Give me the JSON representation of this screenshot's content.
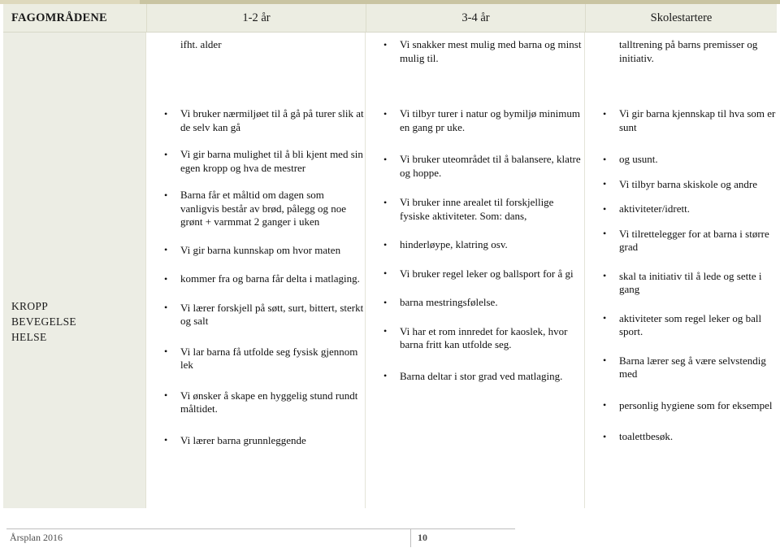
{
  "document": {
    "footer": {
      "left_text": "Årsplan 2016",
      "page_number": "10"
    }
  },
  "table": {
    "headers": {
      "area": "FAGOMRÅDENE",
      "age_1_2": "1-2 år",
      "age_3_4": "3-4 år",
      "school_starters": "Skolestartere"
    },
    "row_label": {
      "line1": "KROPP",
      "line2": "BEVEGELSE",
      "line3": "HELSE"
    },
    "top_row": {
      "col_1_2": "ifht. alder",
      "col_3_4": "Vi snakker mest mulig med barna og minst mulig til.",
      "col_school": "talltrening på barns premisser og initiativ."
    },
    "columns": {
      "age_1_2": [
        "Vi bruker nærmiljøet til å gå på turer slik at de selv kan gå",
        "Vi gir barna mulighet til å bli kjent med sin egen kropp og hva de mestrer",
        "Barna får et måltid om dagen som vanligvis består av brød, pålegg og noe grønt + varmmat 2 ganger i uken",
        "Vi gir barna kunnskap om hvor maten",
        "kommer fra og barna får delta i matlaging.",
        "Vi lærer forskjell på søtt, surt, bittert, sterkt og salt",
        "Vi lar barna få utfolde seg fysisk gjennom lek",
        "Vi ønsker å skape en hyggelig stund rundt måltidet.",
        "Vi lærer barna grunnleggende"
      ],
      "age_3_4": [
        "Vi tilbyr turer i natur og bymiljø minimum en gang pr uke.",
        "Vi bruker uteområdet til å balansere, klatre og hoppe.",
        "Vi bruker inne arealet til forskjellige fysiske aktiviteter. Som: dans,",
        "hinderløype, klatring osv.",
        "Vi bruker regel leker og ballsport for å gi",
        "barna mestringsfølelse.",
        "Vi har et rom innredet for kaoslek, hvor barna fritt kan utfolde seg.",
        "Barna deltar i stor grad ved matlaging."
      ],
      "school_starters": [
        "Vi gir barna kjennskap til hva som er sunt",
        "og usunt.",
        "Vi tilbyr barna skiskole og andre",
        "aktiviteter/idrett.",
        "Vi tilrettelegger for at barna i større grad",
        "skal ta initiativ til å lede og sette i gang",
        "aktiviteter som regel leker og ball sport.",
        "Barna lærer seg å være selvstendig med",
        "personlig hygiene som for eksempel",
        "toalettbesøk."
      ]
    }
  },
  "colors": {
    "header_bg": "#ECEDE2",
    "label_col_bg": "#ECEDE4",
    "rule_khaki": "#C9C4A2",
    "text": "#111111",
    "footer_text": "#4D4D4D"
  }
}
